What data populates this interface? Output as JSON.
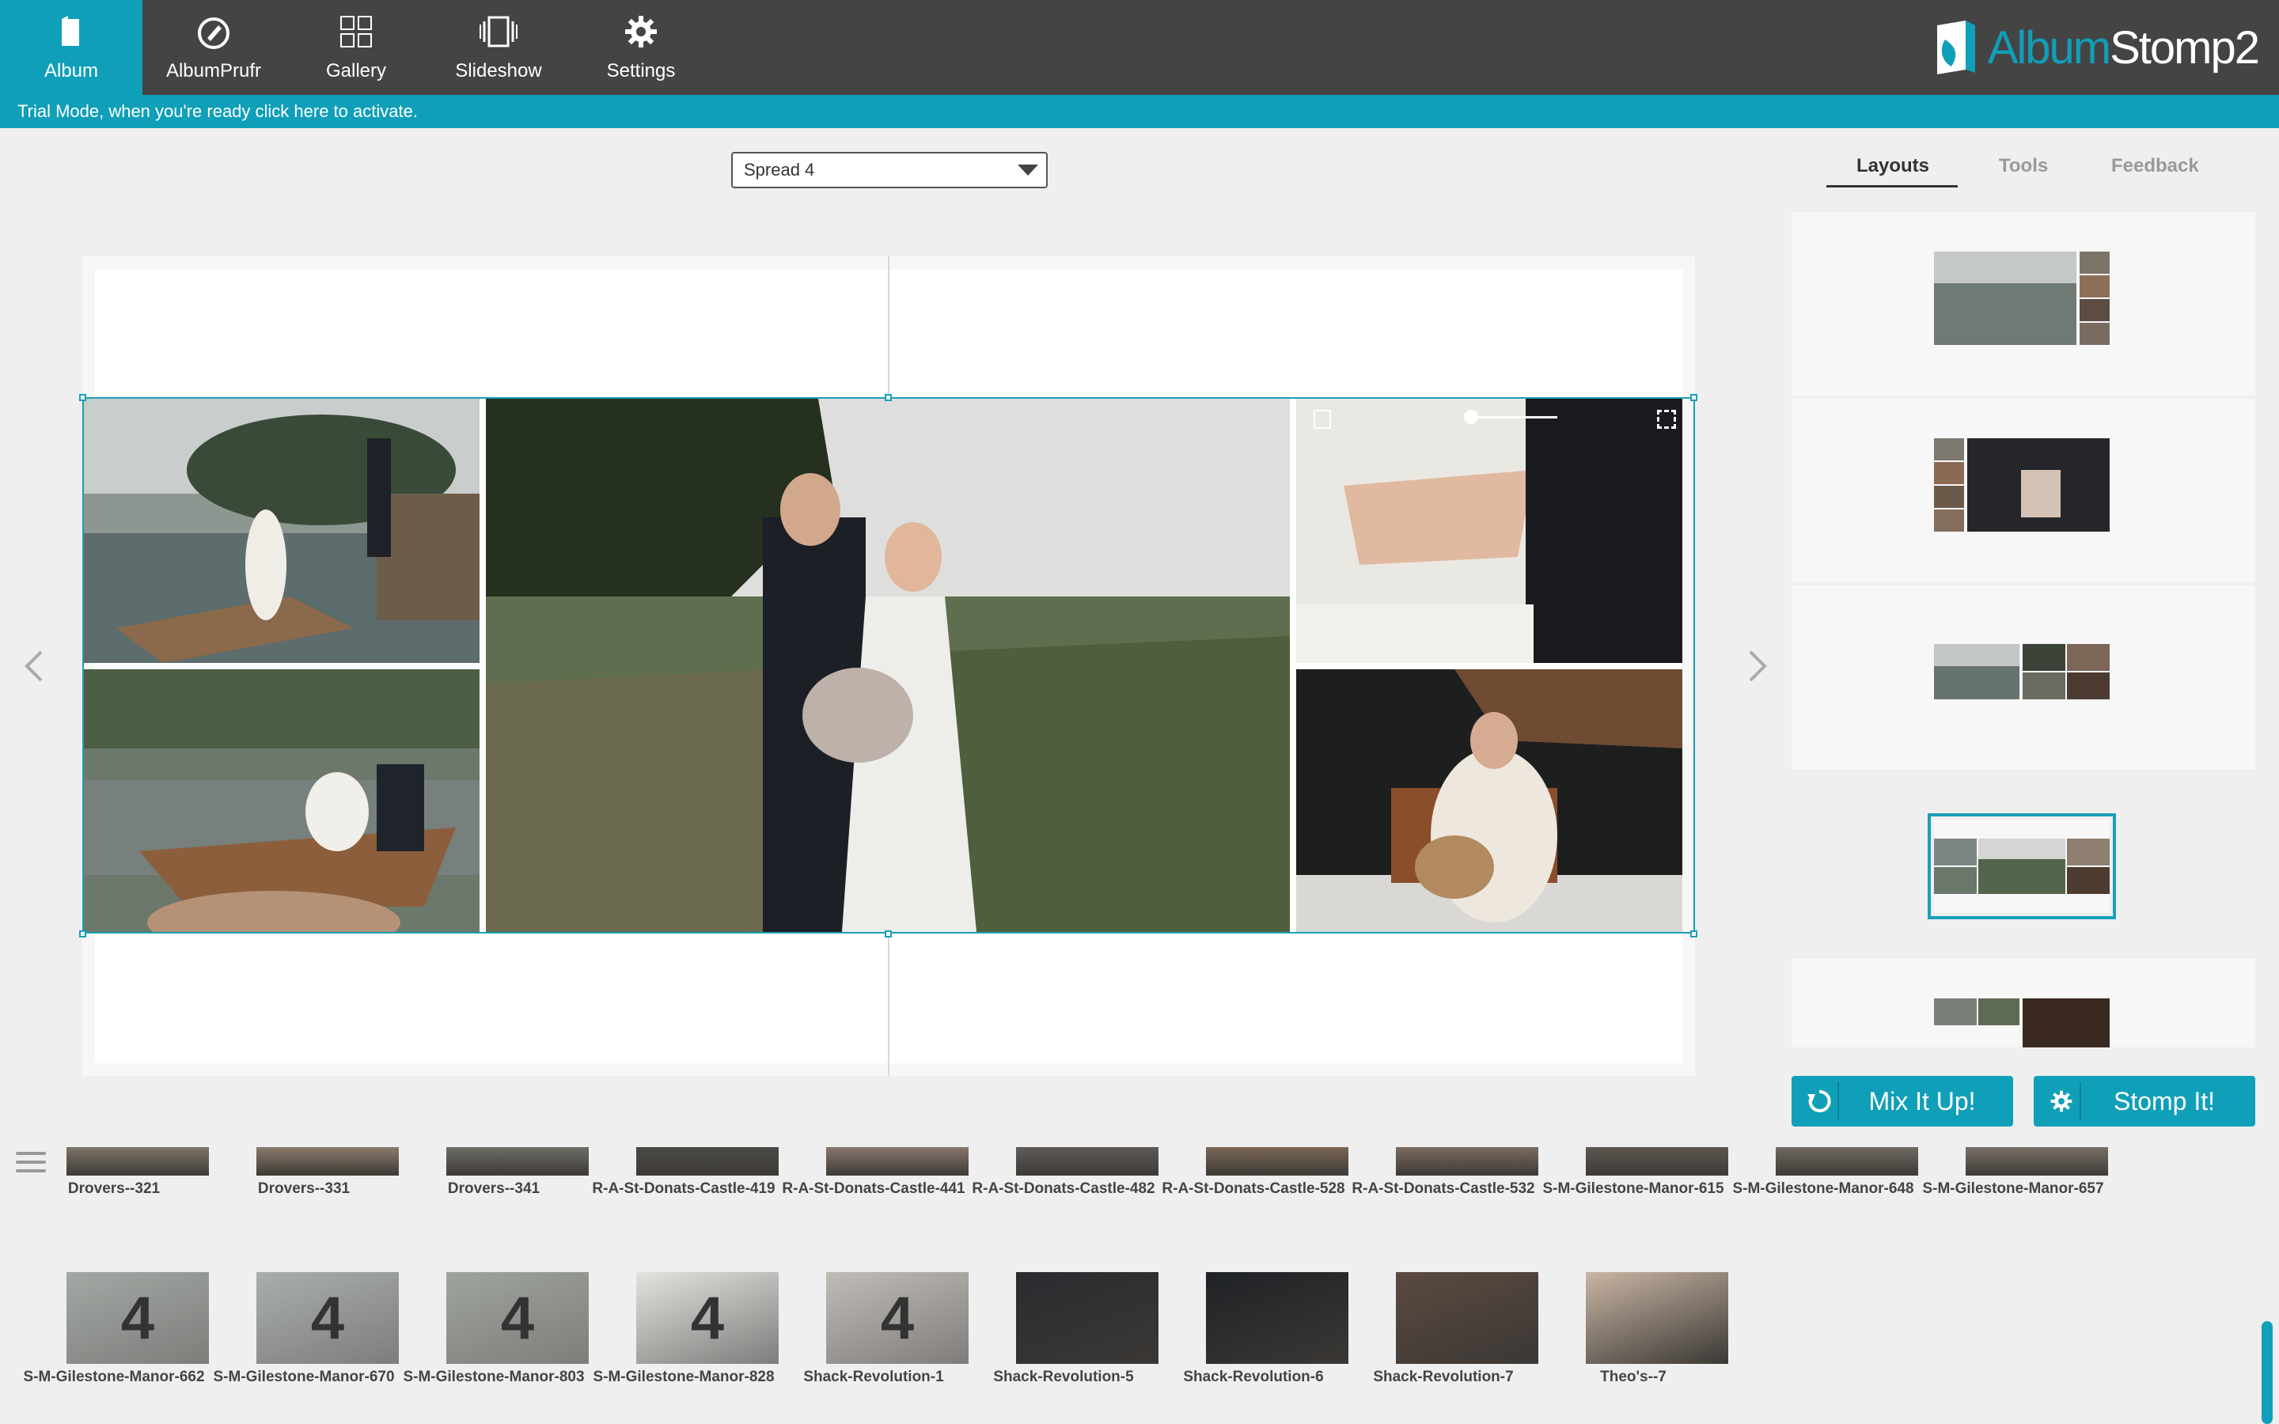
{
  "nav": {
    "items": [
      {
        "label": "Album",
        "icon": "album-icon"
      },
      {
        "label": "AlbumPrufr",
        "icon": "proof-icon"
      },
      {
        "label": "Gallery",
        "icon": "gallery-grid-icon"
      },
      {
        "label": "Slideshow",
        "icon": "slideshow-icon"
      },
      {
        "label": "Settings",
        "icon": "gear-icon"
      }
    ],
    "active": "Album"
  },
  "brand": {
    "part1": "Album",
    "part2": "Stomp2"
  },
  "trial": {
    "text": "Trial Mode, when you're ready click here to activate."
  },
  "spread": {
    "selected": "Spread 4"
  },
  "right_tabs": [
    "Layouts",
    "Tools",
    "Feedback"
  ],
  "active_tab": "Layouts",
  "buttons": {
    "mix": "Mix It Up!",
    "stomp": "Stomp It!"
  },
  "top_row": [
    "Drovers--321",
    "Drovers--331",
    "Drovers--341",
    "R-A-St-Donats-Castle-419",
    "R-A-St-Donats-Castle-441",
    "R-A-St-Donats-Castle-482",
    "R-A-St-Donats-Castle-528",
    "R-A-St-Donats-Castle-532",
    "S-M-Gilestone-Manor-615",
    "S-M-Gilestone-Manor-648",
    "S-M-Gilestone-Manor-657"
  ],
  "bottom_row": [
    {
      "name": "S-M-Gilestone-Manor-662",
      "used": "4"
    },
    {
      "name": "S-M-Gilestone-Manor-670",
      "used": "4"
    },
    {
      "name": "S-M-Gilestone-Manor-803",
      "used": "4"
    },
    {
      "name": "S-M-Gilestone-Manor-828",
      "used": "4"
    },
    {
      "name": "Shack-Revolution-1",
      "used": "4"
    },
    {
      "name": "Shack-Revolution-5",
      "used": ""
    },
    {
      "name": "Shack-Revolution-6",
      "used": ""
    },
    {
      "name": "Shack-Revolution-7",
      "used": ""
    },
    {
      "name": "Theo's--7",
      "used": ""
    }
  ],
  "colors": {
    "accent": "#109fb8",
    "topbar": "#444444"
  }
}
